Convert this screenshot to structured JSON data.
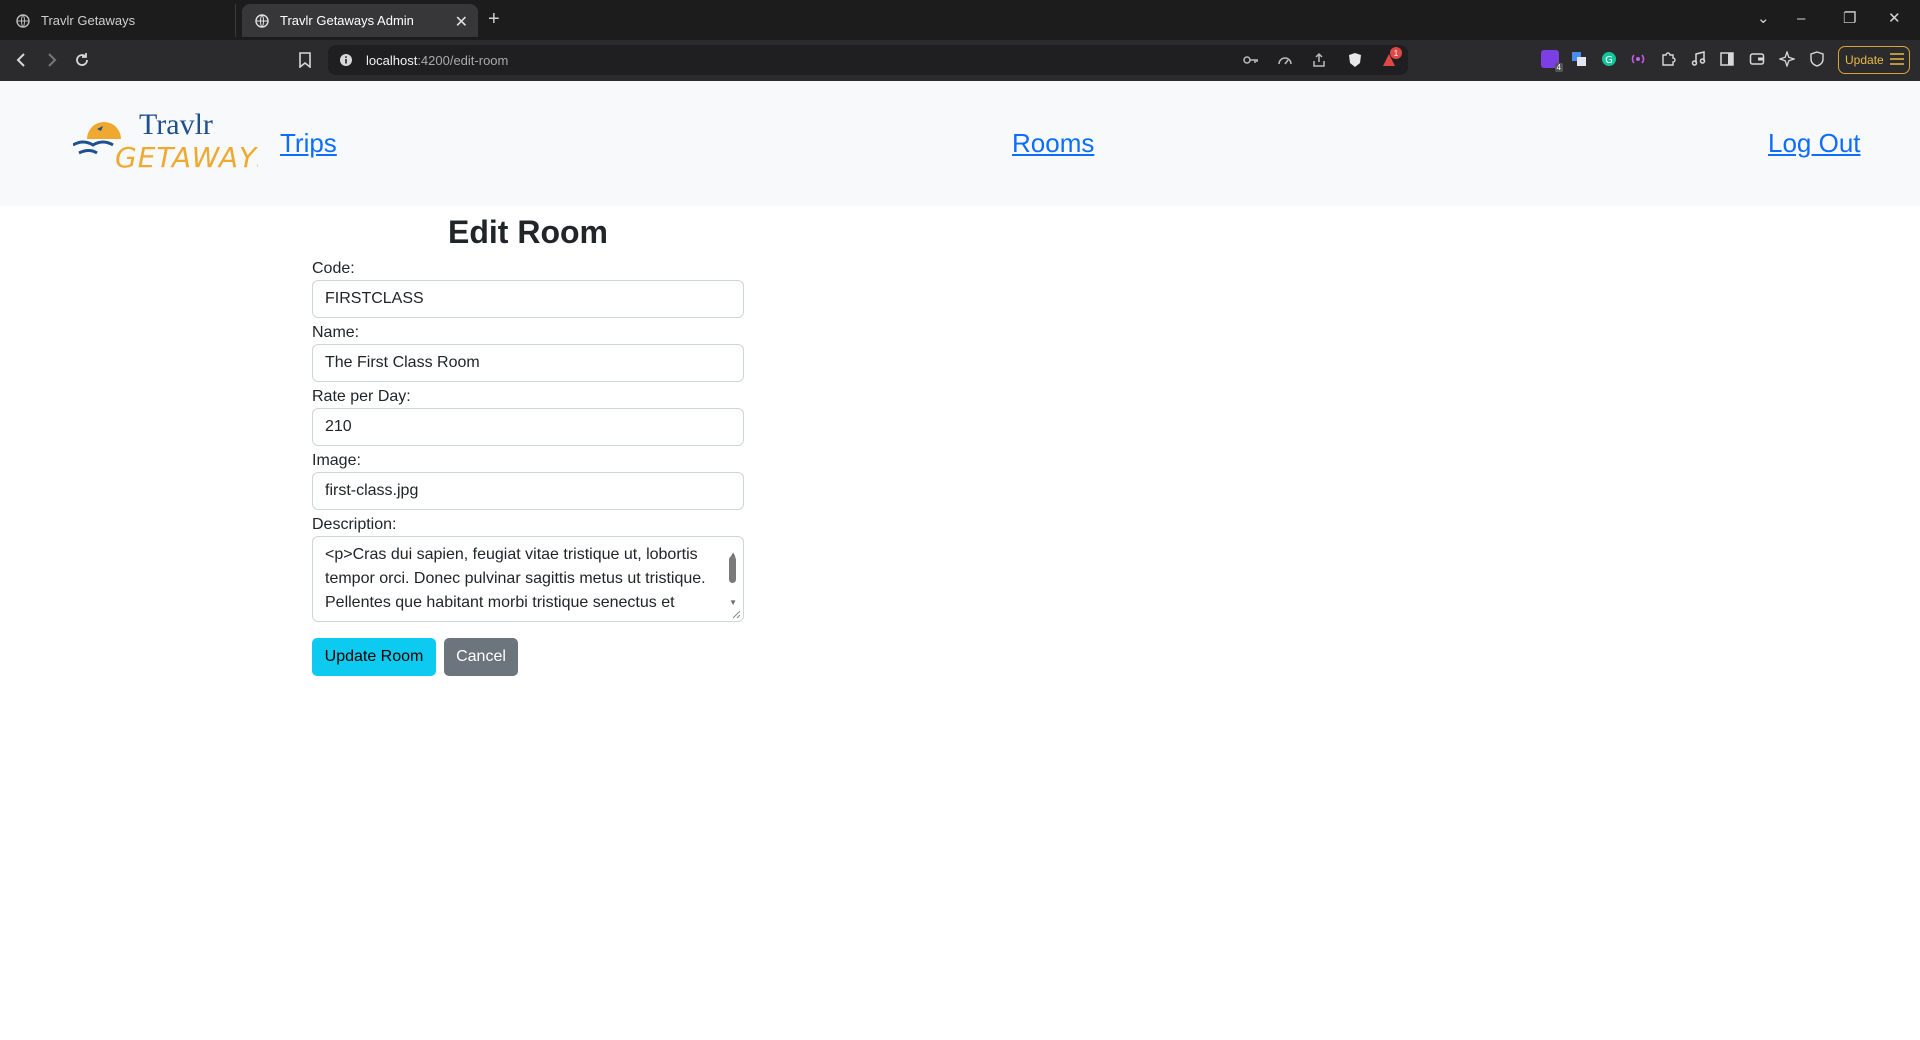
{
  "browser": {
    "tabs": [
      {
        "title": "Travlr Getaways",
        "active": false
      },
      {
        "title": "Travlr Getaways Admin",
        "active": true
      }
    ],
    "url_host": "localhost",
    "url_path": ":4200/edit-room",
    "update_label": "Update",
    "notification_count": "1",
    "extension_badge": "4"
  },
  "site": {
    "logo_line1": "Travlr",
    "logo_line2": "GETAWAYS",
    "nav": {
      "trips": "Trips",
      "rooms": "Rooms",
      "logout": "Log Out"
    }
  },
  "form": {
    "title": "Edit Room",
    "fields": {
      "code": {
        "label": "Code:",
        "value": "FIRSTCLASS"
      },
      "name": {
        "label": "Name:",
        "value": "The First Class Room"
      },
      "rate": {
        "label": "Rate per Day:",
        "value": "210"
      },
      "image": {
        "label": "Image:",
        "value": "first-class.jpg"
      },
      "description": {
        "label": "Description:",
        "value": "<p>Cras dui sapien, feugiat vitae tristique ut, lobortis tempor orci. Donec pulvinar sagittis metus ut tristique. Pellentes que habitant morbi tristique senectus et"
      }
    },
    "buttons": {
      "update": "Update Room",
      "cancel": "Cancel"
    }
  },
  "colors": {
    "link": "#0d6efd",
    "update_button": "#0dcaf0",
    "cancel_button": "#6c757d",
    "nav_bg": "#f8f9fa"
  }
}
